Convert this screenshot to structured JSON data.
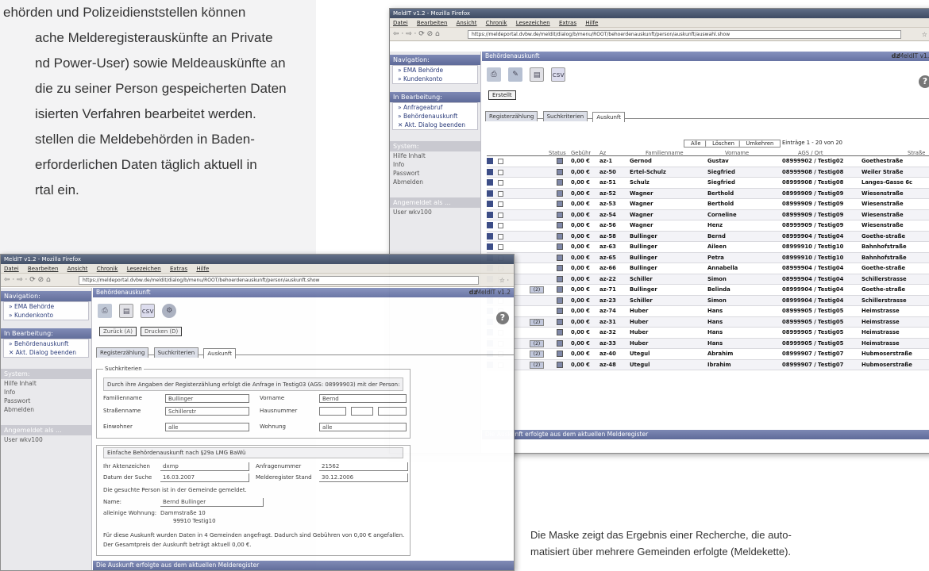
{
  "intro": {
    "lines": [
      "ehörden und Polizeidienststellen können",
      "ache Melderegisterauskünfte an Private",
      "nd Power-User) sowie Meldeauskünfte an",
      "die zu seiner Person gespeicherten Daten",
      "isierten Verfahren bearbeitet werden.",
      "stellen die Meldebehörden in Baden-",
      "erforderlichen Daten täglich aktuell in",
      "rtal ein."
    ]
  },
  "caption": {
    "line1": "Die Maske zeigt das Ergebnis einer Recherche, die auto-",
    "line2": "matisiert über mehrere Gemeinden erfolgte (Meldekette)."
  },
  "winA": {
    "title": "MeldIT v1.2 - Mozilla Firefox",
    "menu": [
      "Datei",
      "Bearbeiten",
      "Ansicht",
      "Chronik",
      "Lesezeichen",
      "Extras",
      "Hilfe"
    ],
    "url": "https://meldeportal.dvbw.de/meldit/dialog/b/menu/ROOT/behoerdenauskunft/person/auskunft/auswahl.show",
    "nav_arrows": "⇦ · ⇨ · ⟳ ⊘ ⌂",
    "nav_right": "☆ ·",
    "sidebar": {
      "navigation_head": "Navigation:",
      "navigation_items": [
        "» EMA Behörde",
        "» Kundenkonto"
      ],
      "work_head": "In Bearbeitung:",
      "work_items": [
        "» Anfrageabruf",
        "» Behördenauskunft",
        "✕ Akt. Dialog beenden"
      ],
      "system_head": "System:",
      "system_items": [
        "Hilfe Inhalt",
        "Info",
        "Passwort",
        "Abmelden"
      ],
      "login_head": "Angemeldet als ...",
      "login_user": "User      wkv100"
    },
    "content_title": "Behördenauskunft",
    "brand": "dz",
    "version": "MeldIT v1.2",
    "csv_label": "csv",
    "help": "?",
    "button_create": "Erstellt",
    "tabs": [
      "Registerzählung",
      "Suchkriterien",
      "Auskunft"
    ],
    "links": [
      "Alle",
      "Löschen",
      "Umkehren"
    ],
    "entries": "Einträge 1 - 20 von 20",
    "headers": {
      "status": "Status",
      "fee": "Gebühr",
      "az": "Az",
      "name": "Familienname",
      "first": "Vorname",
      "ags": "AGS / Ort",
      "street": "Straße"
    },
    "rows": [
      {
        "fee": "0,00 €",
        "az": "az-1",
        "name": "Gernod",
        "first": "Gustav",
        "ags": "08999902 / Testig02",
        "street": "Goethestraße"
      },
      {
        "fee": "0,00 €",
        "az": "az-50",
        "name": "Ertel-Schulz",
        "first": "Siegfried",
        "ags": "08999908 / Testig08",
        "street": "Weiler Straße"
      },
      {
        "fee": "0,00 €",
        "az": "az-51",
        "name": "Schulz",
        "first": "Siegfried",
        "ags": "08999908 / Testig08",
        "street": "Langes-Gasse 6c"
      },
      {
        "fee": "0,00 €",
        "az": "az-52",
        "name": "Wagner",
        "first": "Berthold",
        "ags": "08999909 / Testig09",
        "street": "Wiesenstraße"
      },
      {
        "fee": "0,00 €",
        "az": "az-53",
        "name": "Wagner",
        "first": "Berthold",
        "ags": "08999909 / Testig09",
        "street": "Wiesenstraße"
      },
      {
        "fee": "0,00 €",
        "az": "az-54",
        "name": "Wagner",
        "first": "Corneline",
        "ags": "08999909 / Testig09",
        "street": "Wiesenstraße"
      },
      {
        "fee": "0,00 €",
        "az": "az-56",
        "name": "Wagner",
        "first": "Henz",
        "ags": "08999909 / Testig09",
        "street": "Wiesenstraße"
      },
      {
        "fee": "0,00 €",
        "az": "az-58",
        "name": "Bullinger",
        "first": "Bernd",
        "ags": "08999904 / Testig04",
        "street": "Goethe-straße"
      },
      {
        "fee": "0,00 €",
        "az": "az-63",
        "name": "Bullinger",
        "first": "Aileen",
        "ags": "08999910 / Testig10",
        "street": "Bahnhofstraße"
      },
      {
        "fee": "0,00 €",
        "az": "az-65",
        "name": "Bullinger",
        "first": "Petra",
        "ags": "08999910 / Testig10",
        "street": "Bahnhofstraße"
      },
      {
        "fee": "0,00 €",
        "az": "az-66",
        "name": "Bullinger",
        "first": "Annabella",
        "ags": "08999904 / Testig04",
        "street": "Goethe-straße"
      },
      {
        "fee": "0,00 €",
        "az": "az-22",
        "name": "Schiller",
        "first": "Simon",
        "ags": "08999904 / Testig04",
        "street": "Schillerstrasse"
      },
      {
        "fee": "0,00 €",
        "az": "az-71",
        "name": "Bullinger",
        "first": "Belinda",
        "ags": "08999904 / Testig04",
        "street": "Goethe-straße",
        "count": "(2)"
      },
      {
        "fee": "0,00 €",
        "az": "az-23",
        "name": "Schiller",
        "first": "Simon",
        "ags": "08999904 / Testig04",
        "street": "Schillerstrasse"
      },
      {
        "fee": "0,00 €",
        "az": "az-74",
        "name": "Huber",
        "first": "Hans",
        "ags": "08999905 / Testig05",
        "street": "Heimstrasse"
      },
      {
        "fee": "0,00 €",
        "az": "az-31",
        "name": "Huber",
        "first": "Hans",
        "ags": "08999905 / Testig05",
        "street": "Heimstrasse",
        "count": "(2)"
      },
      {
        "fee": "0,00 €",
        "az": "az-32",
        "name": "Huber",
        "first": "Hans",
        "ags": "08999905 / Testig05",
        "street": "Heimstrasse"
      },
      {
        "fee": "0,00 €",
        "az": "az-33",
        "name": "Huber",
        "first": "Hans",
        "ags": "08999905 / Testig05",
        "street": "Heimstrasse",
        "count": "(2)"
      },
      {
        "fee": "0,00 €",
        "az": "az-40",
        "name": "Ütegul",
        "first": "Abrahim",
        "ags": "08999907 / Testig07",
        "street": "Hubmoserstraße",
        "count": "(2)"
      },
      {
        "fee": "0,00 €",
        "az": "az-48",
        "name": "Ütegul",
        "first": "Ibrahim",
        "ags": "08999907 / Testig07",
        "street": "Hubmoserstraße",
        "count": "(2)"
      }
    ],
    "footer": "Die Auskunft erfolgte aus dem aktuellen Melderegister"
  },
  "winB": {
    "title": "MeldIT v1.2 - Mozilla Firefox",
    "menu": [
      "Datei",
      "Bearbeiten",
      "Ansicht",
      "Chronik",
      "Lesezeichen",
      "Extras",
      "Hilfe"
    ],
    "url": "https://meldeportal.dvbw.de/meldit/dialog/b/menu/ROOT/behoerdenauskunft/person/auskunft.show",
    "sidebar": {
      "navigation_head": "Navigation:",
      "navigation_items": [
        "» EMA Behörde",
        "» Kundenkonto"
      ],
      "work_head": "In Bearbeitung:",
      "work_items": [
        "» Behördenauskunft",
        "✕ Akt. Dialog beenden"
      ],
      "system_head": "System:",
      "system_items": [
        "Hilfe Inhalt",
        "Info",
        "Passwort",
        "Abmelden"
      ],
      "login_head": "Angemeldet als ...",
      "login_user": "User      wkv100"
    },
    "content_title": "Behördenauskunft",
    "brand": "dz",
    "version": "MeldIT v1.2",
    "csv_label": "csv",
    "help": "?",
    "buttons": [
      "Zurück (A)",
      "Drucken (D)"
    ],
    "tabs": [
      "Registerzählung",
      "Suchkriterien",
      "Auskunft"
    ],
    "search": {
      "legend": "Suchkriterien",
      "info": "Durch ihre Angaben der Registerzählung erfolgt die Anfrage in Testig03 (AGS: 08999903) mit der Person:",
      "lbl_family": "Familienname",
      "val_family": "Bullinger",
      "lbl_first": "Vorname",
      "val_first": "Bernd",
      "lbl_street": "Straßenname",
      "val_street": "Schillerstr",
      "lbl_house": "Hausnummer",
      "lbl_resident": "Einwohner",
      "val_resident": "alle",
      "lbl_home": "Wohnung",
      "val_home": "alle"
    },
    "result": {
      "legend": "Einfache Behördenauskunft nach §29a LMG BaWü",
      "lbl_file": "Ihr Aktenzeichen",
      "val_file": "dxmp",
      "lbl_req": "Anfragenummer",
      "val_req": "21562",
      "lbl_date": "Datum der Suche",
      "val_date": "16.03.2007",
      "lbl_status": "Melderegister Stand",
      "val_status": "30.12.2006",
      "found": "Die gesuchte Person ist in der Gemeinde gemeldet.",
      "lbl_name": "Name:",
      "val_name": "Bernd Bullinger",
      "lbl_addr": "alleinige Wohnung:",
      "val_addr1": "Dammstraße 10",
      "val_addr2": "99910 Testig10",
      "note1": "Für diese Auskunft wurden Daten in 4 Gemeinden angefragt. Dadurch sind Gebühren von 0,00 € angefallen.",
      "note2": "Der Gesamtpreis der Auskunft beträgt aktuell 0,00 €."
    },
    "footer": "Die Auskunft erfolgte aus dem aktuellen Melderegister"
  }
}
